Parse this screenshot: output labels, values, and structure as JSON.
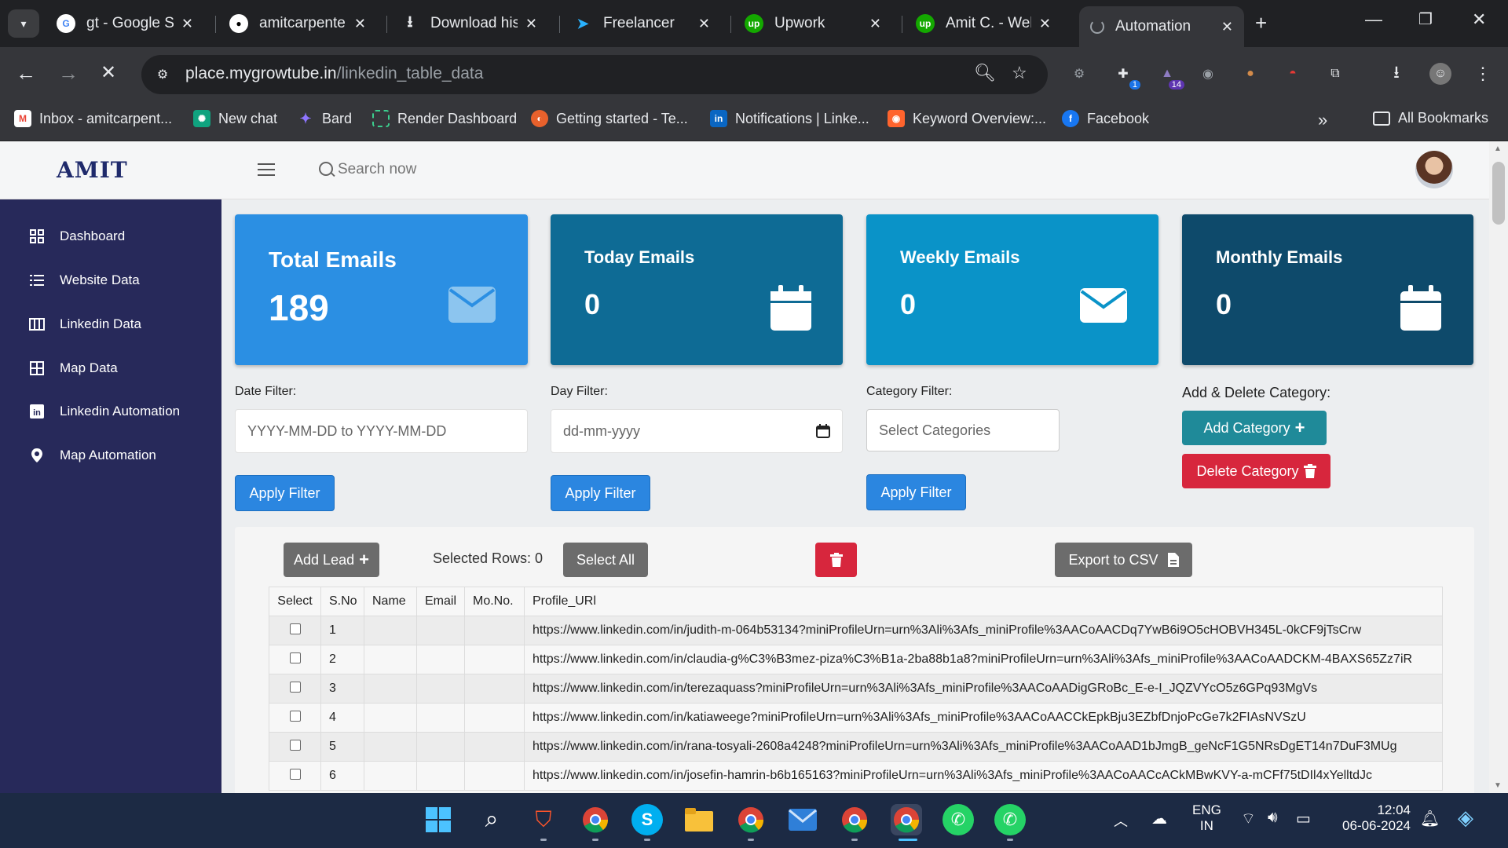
{
  "browser": {
    "tabs": [
      {
        "label": "gt - Google Se",
        "icon": "google-icon"
      },
      {
        "label": "amitcarpenter",
        "icon": "github-icon"
      },
      {
        "label": "Download hist",
        "icon": "download-icon"
      },
      {
        "label": "Freelancer",
        "icon": "freelancer-icon"
      },
      {
        "label": "Upwork",
        "icon": "upwork-icon"
      },
      {
        "label": "Amit C. - Web",
        "icon": "upwork-icon"
      },
      {
        "label": "Automation",
        "icon": "loading-icon",
        "active": true
      }
    ],
    "url_host": "place.mygrowtube.in",
    "url_path": "/linkedin_table_data",
    "extension_badges": {
      "ext1": "1",
      "ext2": "14"
    },
    "bookmarks": [
      {
        "label": "Inbox - amitcarpent...",
        "icon": "gmail-icon",
        "color": "#ea4335"
      },
      {
        "label": "New chat",
        "icon": "openai-icon",
        "color": "#10a37f"
      },
      {
        "label": "Bard",
        "icon": "bard-icon",
        "color": "#8e75ff"
      },
      {
        "label": "Render Dashboard",
        "icon": "render-icon",
        "color": "#3ccf8e"
      },
      {
        "label": "Getting started - Te...",
        "icon": "getting-started-icon",
        "color": "#e8612c"
      },
      {
        "label": "Notifications | Linke...",
        "icon": "linkedin-icon",
        "color": "#0a66c2"
      },
      {
        "label": "Keyword Overview:...",
        "icon": "semrush-icon",
        "color": "#ff642d"
      },
      {
        "label": "Facebook",
        "icon": "facebook-icon",
        "color": "#1877f2"
      }
    ],
    "all_bookmarks": "All Bookmarks"
  },
  "app": {
    "brand": "AMIT",
    "search_placeholder": "Search now"
  },
  "sidebar": {
    "items": [
      {
        "label": "Dashboard",
        "icon": "dashboard-icon"
      },
      {
        "label": "Website Data",
        "icon": "list-icon"
      },
      {
        "label": "Linkedin Data",
        "icon": "columns-icon"
      },
      {
        "label": "Map Data",
        "icon": "table-icon"
      },
      {
        "label": "Linkedin Automation",
        "icon": "linkedin-icon"
      },
      {
        "label": "Map Automation",
        "icon": "map-pin-icon"
      }
    ]
  },
  "cards": [
    {
      "title": "Total Emails",
      "value": "189",
      "color": "#2b8fe3",
      "icon": "envelope-icon"
    },
    {
      "title": "Today Emails",
      "value": "0",
      "color": "#0e6b95",
      "icon": "calendar-icon"
    },
    {
      "title": "Weekly Emails",
      "value": "0",
      "color": "#0a93c8",
      "icon": "envelope-icon"
    },
    {
      "title": "Monthly Emails",
      "value": "0",
      "color": "#0e4a6b",
      "icon": "calendar-icon"
    }
  ],
  "filters": {
    "date_label": "Date Filter:",
    "date_placeholder": "YYYY-MM-DD to YYYY-MM-DD",
    "day_label": "Day Filter:",
    "day_placeholder": "dd-mm-yyyy",
    "category_label": "Category Filter:",
    "category_placeholder": "Select Categories",
    "apply_label": "Apply Filter",
    "category_section_label": "Add & Delete Category:",
    "add_category": "Add Category",
    "delete_category": "Delete Category"
  },
  "table_controls": {
    "add_lead": "Add Lead",
    "selected_rows": "Selected Rows: 0",
    "select_all": "Select All",
    "export_csv": "Export to CSV"
  },
  "table": {
    "headers": [
      "Select",
      "S.No",
      "Name",
      "Email",
      "Mo.No.",
      "Profile_URl"
    ],
    "rows": [
      {
        "sno": "1",
        "name": "",
        "email": "",
        "mobile": "",
        "url": "https://www.linkedin.com/in/judith-m-064b53134?miniProfileUrn=urn%3Ali%3Afs_miniProfile%3AACoAACDq7YwB6i9O5cHOBVH345L-0kCF9jTsCrw"
      },
      {
        "sno": "2",
        "name": "",
        "email": "",
        "mobile": "",
        "url": "https://www.linkedin.com/in/claudia-g%C3%B3mez-piza%C3%B1a-2ba88b1a8?miniProfileUrn=urn%3Ali%3Afs_miniProfile%3AACoAADCKM-4BAXS65Zz7iR"
      },
      {
        "sno": "3",
        "name": "",
        "email": "",
        "mobile": "",
        "url": "https://www.linkedin.com/in/terezaquass?miniProfileUrn=urn%3Ali%3Afs_miniProfile%3AACoAADigGRoBc_E-e-I_JQZVYcO5z6GPq93MgVs"
      },
      {
        "sno": "4",
        "name": "",
        "email": "",
        "mobile": "",
        "url": "https://www.linkedin.com/in/katiaweege?miniProfileUrn=urn%3Ali%3Afs_miniProfile%3AACoAACCkEpkBju3EZbfDnjoPcGe7k2FIAsNVSzU"
      },
      {
        "sno": "5",
        "name": "",
        "email": "",
        "mobile": "",
        "url": "https://www.linkedin.com/in/rana-tosyali-2608a4248?miniProfileUrn=urn%3Ali%3Afs_miniProfile%3AACoAAD1bJmgB_geNcF1G5NRsDgET14n7DuF3MUg"
      },
      {
        "sno": "6",
        "name": "",
        "email": "",
        "mobile": "",
        "url": "https://www.linkedin.com/in/josefin-hamrin-b6b165163?miniProfileUrn=urn%3Ali%3Afs_miniProfile%3AACoAACcACkMBwKVY-a-mCFf75tDIl4xYelltdJc"
      }
    ]
  },
  "taskbar": {
    "lang_top": "ENG",
    "lang_bottom": "IN",
    "time": "12:04",
    "date": "06-06-2024"
  }
}
